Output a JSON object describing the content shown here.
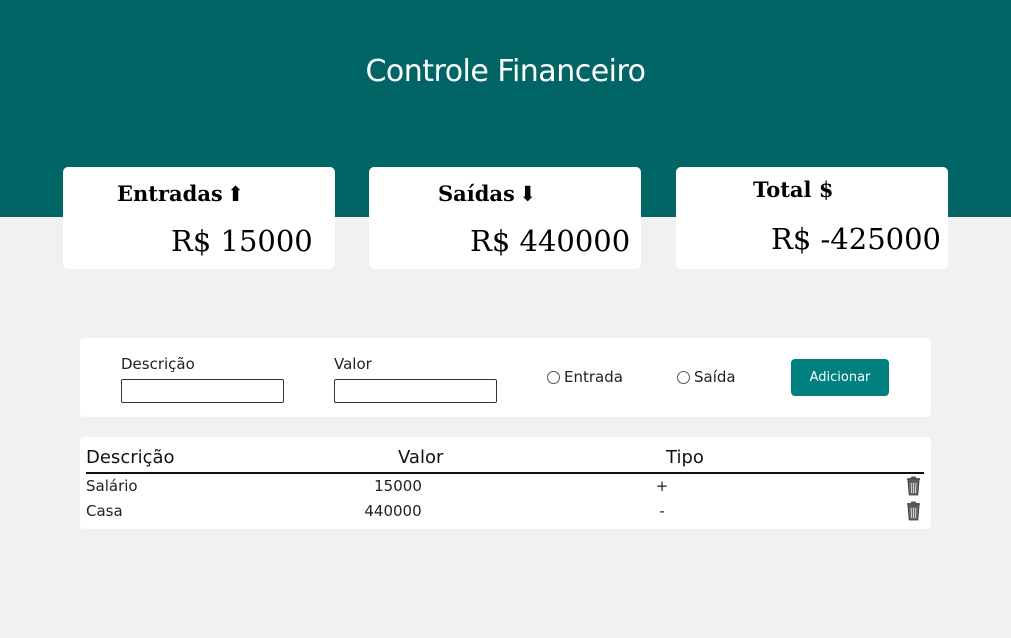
{
  "app": {
    "title": "Controle Financeiro"
  },
  "summary": {
    "income": {
      "label": "Entradas",
      "arrow": "⬆",
      "value": "R$ 15000"
    },
    "expenses": {
      "label": "Saídas",
      "arrow": "⬇",
      "value": "R$ 440000"
    },
    "total": {
      "label": "Total $",
      "value": "R$ -425000"
    }
  },
  "form": {
    "description_label": "Descrição",
    "description_value": "",
    "amount_label": "Valor",
    "amount_value": "",
    "radio_income_label": "Entrada",
    "radio_expense_label": "Saída",
    "add_button_label": "Adicionar"
  },
  "table": {
    "headers": {
      "description": "Descrição",
      "amount": "Valor",
      "type": "Tipo"
    },
    "rows": [
      {
        "description": "Salário",
        "amount": "15000",
        "type": "+",
        "delete_icon": "trash-icon"
      },
      {
        "description": "Casa",
        "amount": "440000",
        "type": "-",
        "delete_icon": "trash-icon"
      }
    ]
  },
  "colors": {
    "header_bg": "#006564",
    "page_bg": "#f1f1f1",
    "button_bg": "#00807f"
  }
}
